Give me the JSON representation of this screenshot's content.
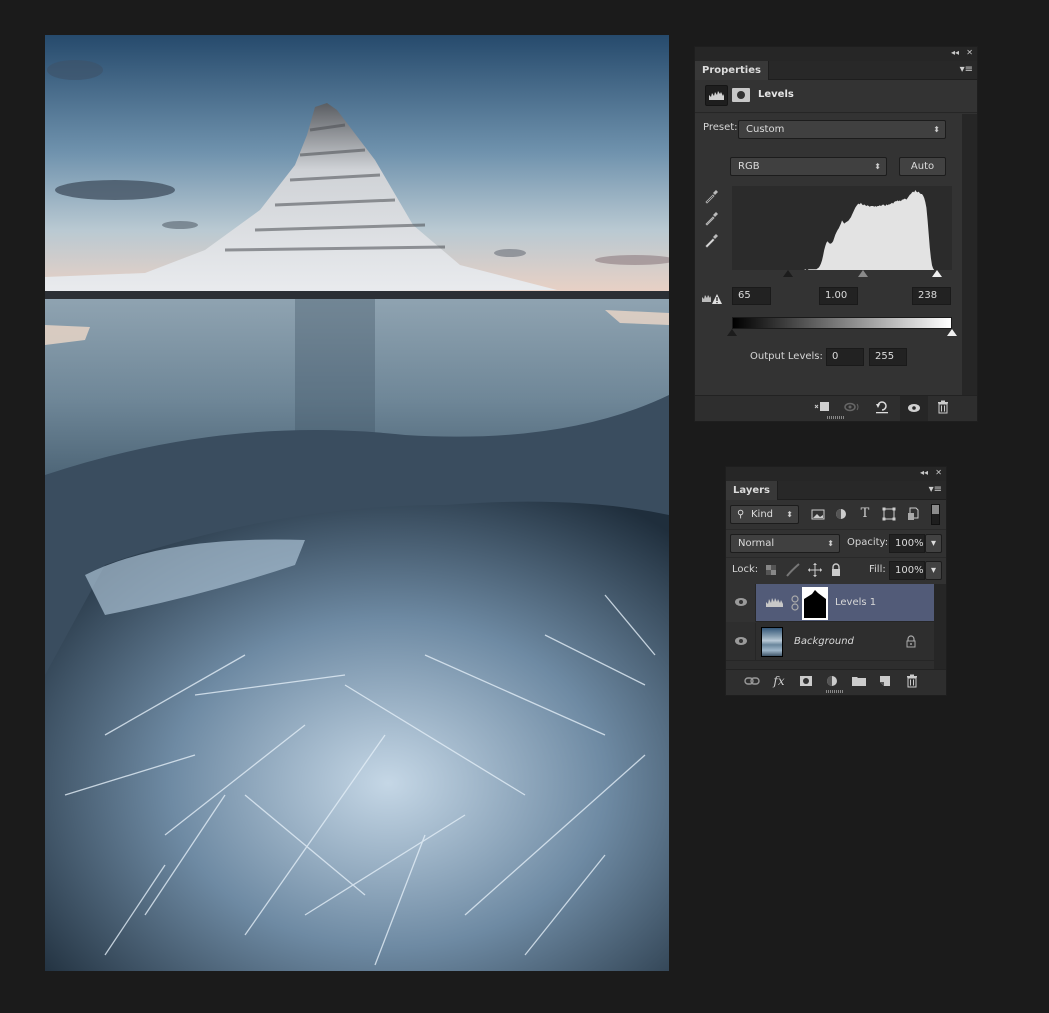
{
  "canvas": {
    "description": "Photo: snow-covered conical mountain (Kirkjufell) at dusk behind a partially frozen lake with shattered ice in foreground",
    "colors": {
      "sky_top": "#2c4e6e",
      "sky_horizon": "#e9d2c6",
      "water": "#7f95a6",
      "ice": "#9fb8cc"
    }
  },
  "properties_panel": {
    "collapse_label": "◂◂",
    "close_label": "✕",
    "tab_label": "Properties",
    "menu_label": "▾≡",
    "adjustment_title": "Levels",
    "preset_label": "Preset:",
    "preset_value": "Custom",
    "channel_value": "RGB",
    "auto_label": "Auto",
    "input_levels": {
      "black": "65",
      "gamma": "1.00",
      "white": "238"
    },
    "output_levels_label": "Output Levels:",
    "output_levels": {
      "black": "0",
      "white": "255"
    },
    "histogram": {
      "input_black": 65,
      "input_gamma": 1.0,
      "input_white": 238,
      "profile": [
        0,
        0,
        0,
        0,
        0,
        0,
        0,
        0,
        0,
        0,
        0,
        0,
        0,
        0,
        0,
        0,
        0,
        0,
        0,
        0,
        0,
        0,
        0,
        0,
        0,
        0,
        0,
        0,
        0,
        0,
        0,
        0,
        0,
        0,
        0,
        0,
        0,
        0,
        0,
        0,
        0,
        0,
        0,
        0,
        0,
        0,
        0,
        0,
        0,
        0,
        0,
        0,
        0,
        0,
        0,
        0,
        0,
        0,
        0,
        0,
        0,
        0,
        0,
        0,
        0,
        0,
        0.01,
        0,
        0,
        0.01,
        0.01,
        0.01,
        0.01,
        0.01,
        0.01,
        0.01,
        0.01,
        0.02,
        0.03,
        0.05,
        0.08,
        0.12,
        0.18,
        0.25,
        0.3,
        0.34,
        0.36,
        0.34,
        0.33,
        0.33,
        0.34,
        0.36,
        0.4,
        0.44,
        0.47,
        0.5,
        0.52,
        0.55,
        0.58,
        0.62,
        0.6,
        0.58,
        0.59,
        0.6,
        0.61,
        0.62,
        0.64,
        0.66,
        0.69,
        0.72,
        0.75,
        0.78,
        0.8,
        0.82,
        0.83,
        0.82,
        0.84,
        0.82,
        0.81,
        0.82,
        0.81,
        0.8,
        0.81,
        0.8,
        0.79,
        0.8,
        0.8,
        0.8,
        0.79,
        0.8,
        0.79,
        0.8,
        0.8,
        0.81,
        0.8,
        0.81,
        0.82,
        0.81,
        0.8,
        0.82,
        0.81,
        0.82,
        0.82,
        0.83,
        0.84,
        0.83,
        0.85,
        0.86,
        0.86,
        0.87,
        0.86,
        0.87,
        0.86,
        0.88,
        0.88,
        0.89,
        0.89,
        0.88,
        0.9,
        0.92,
        0.94,
        0.95,
        0.97,
        0.98,
        0.97,
        1.0,
        0.98,
        0.97,
        0.98,
        0.96,
        0.95,
        0.95,
        0.93,
        0.9,
        0.85,
        0.78,
        0.62,
        0.45,
        0.28,
        0.15,
        0.06,
        0.02,
        0,
        0,
        0,
        0,
        0,
        0,
        0,
        0,
        0,
        0,
        0,
        0,
        0,
        0,
        0,
        0,
        0
      ]
    }
  },
  "layers_panel": {
    "collapse_label": "◂◂",
    "close_label": "✕",
    "tab_label": "Layers",
    "menu_label": "▾≡",
    "filter_kind": "Kind",
    "blend_mode": "Normal",
    "opacity_label": "Opacity:",
    "opacity_value": "100%",
    "lock_label": "Lock:",
    "fill_label": "Fill:",
    "fill_value": "100%",
    "layers": [
      {
        "name": "Levels 1",
        "type": "adjustment",
        "visible": true,
        "selected": true
      },
      {
        "name": "Background",
        "type": "pixel",
        "visible": true,
        "locked": true
      }
    ]
  }
}
